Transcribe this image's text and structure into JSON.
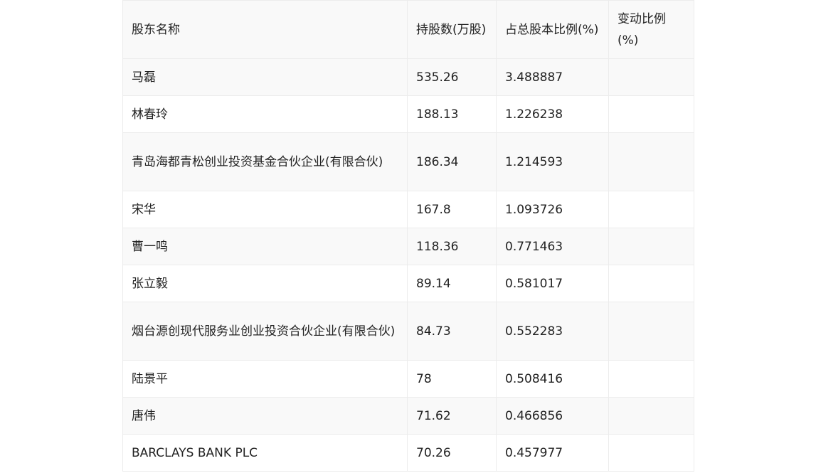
{
  "table": {
    "headers": [
      "股东名称",
      "持股数(万股)",
      "占总股本比例(%)",
      "变动比例(%)"
    ],
    "rows": [
      {
        "name": "马磊",
        "shares": "535.26",
        "ratio": "3.488887",
        "change": ""
      },
      {
        "name": "林春玲",
        "shares": "188.13",
        "ratio": "1.226238",
        "change": ""
      },
      {
        "name": "青岛海都青松创业投资基金合伙企业(有限合伙)",
        "shares": "186.34",
        "ratio": "1.214593",
        "change": ""
      },
      {
        "name": "宋华",
        "shares": "167.8",
        "ratio": "1.093726",
        "change": ""
      },
      {
        "name": "曹一鸣",
        "shares": "118.36",
        "ratio": "0.771463",
        "change": ""
      },
      {
        "name": "张立毅",
        "shares": "89.14",
        "ratio": "0.581017",
        "change": ""
      },
      {
        "name": "烟台源创现代服务业创业投资合伙企业(有限合伙)",
        "shares": "84.73",
        "ratio": "0.552283",
        "change": ""
      },
      {
        "name": "陆景平",
        "shares": "78",
        "ratio": "0.508416",
        "change": ""
      },
      {
        "name": "唐伟",
        "shares": "71.62",
        "ratio": "0.466856",
        "change": ""
      },
      {
        "name": "BARCLAYS BANK PLC",
        "shares": "70.26",
        "ratio": "0.457977",
        "change": ""
      }
    ]
  }
}
